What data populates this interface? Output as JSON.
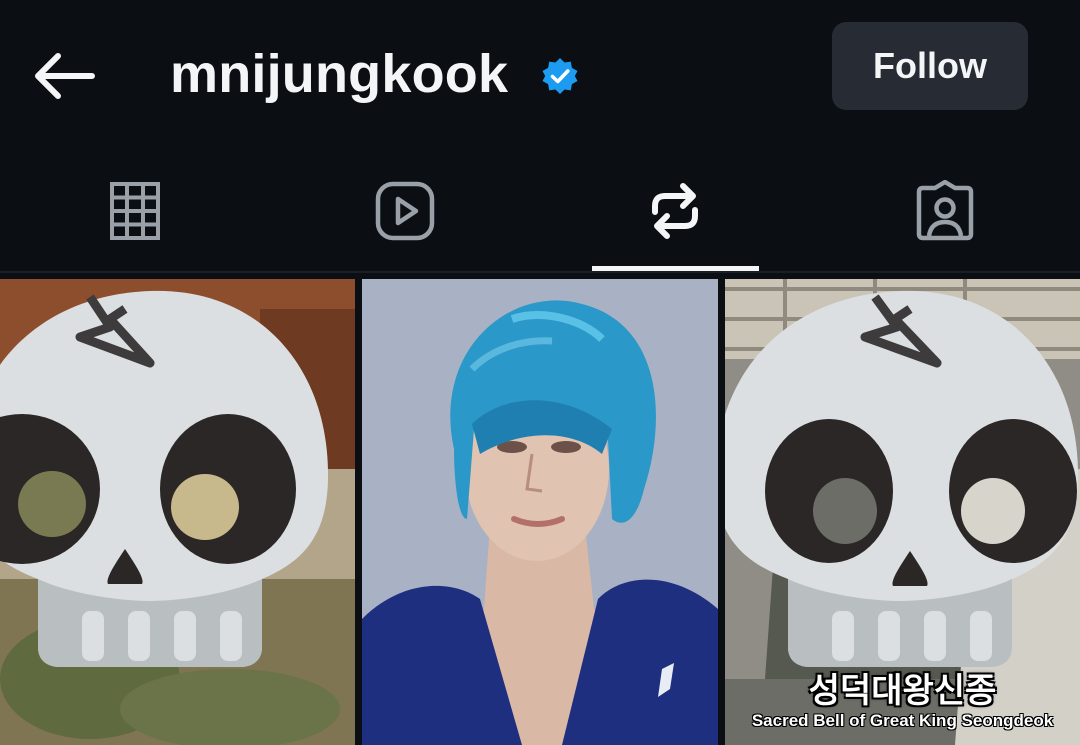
{
  "header": {
    "back_icon": "arrow-left-icon",
    "username": "mnijungkook",
    "verified_icon": "verified-badge-icon",
    "verified_color": "#1d9bf0",
    "follow_label": "Follow"
  },
  "tabs": [
    {
      "icon": "grid-icon",
      "selected": false
    },
    {
      "icon": "reels-play-icon",
      "selected": false
    },
    {
      "icon": "reposts-icon",
      "selected": true
    },
    {
      "icon": "tagged-person-icon",
      "selected": false
    }
  ],
  "posts": [
    {
      "type": "image",
      "overlay": "skull-emoji"
    },
    {
      "type": "image",
      "subject": "person with blue hair"
    },
    {
      "type": "video",
      "overlay": "skull-emoji",
      "caption_ko": "성덕대왕신종",
      "caption_en": "Sacred Bell of Great King Seongdeok"
    }
  ],
  "colors": {
    "background": "#0b0f14",
    "follow_button_bg": "#272b33",
    "text": "#f3f5f7",
    "icon_inactive": "#9aa0a8"
  }
}
